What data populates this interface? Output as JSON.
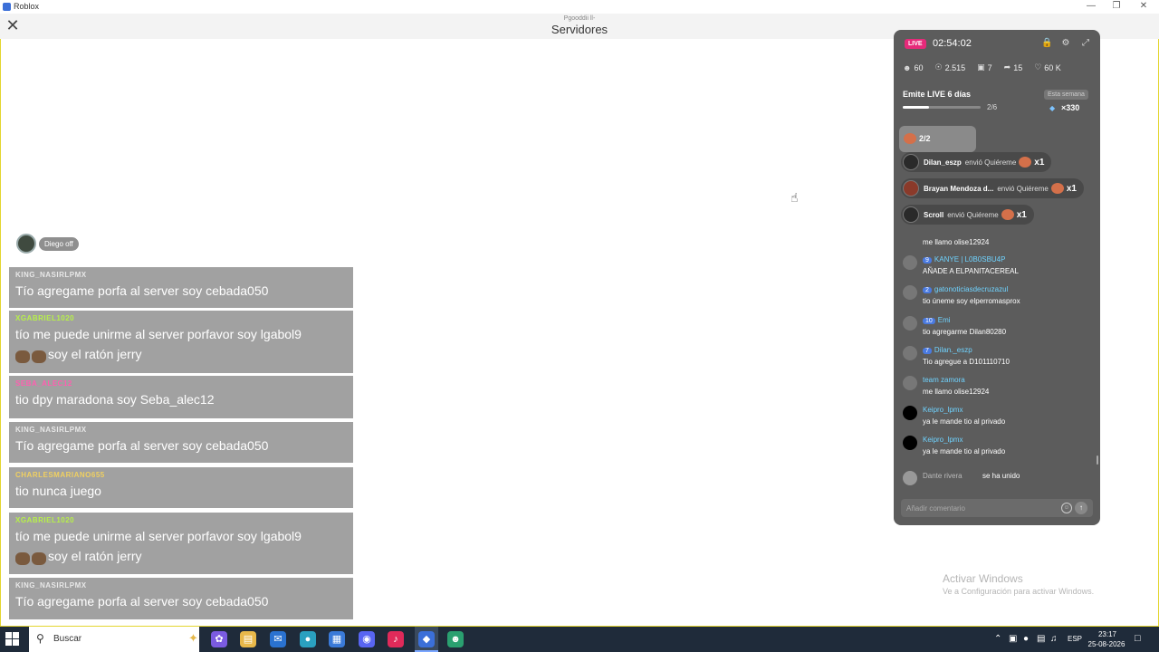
{
  "window": {
    "title": "Roblox",
    "minimize_icon": "minimize-icon",
    "maximize_icon": "maximize-icon",
    "close_icon": "close-icon"
  },
  "header": {
    "subtitle": "Pgooddii ll-",
    "title": "Servidores",
    "close_icon": "close-icon"
  },
  "viewer": {
    "name": "Diego off"
  },
  "chat": [
    {
      "user": "KING_NASIRLPMX",
      "user_color": "#e8e8e8",
      "text": "Tío agregame porfa al server soy cebada050",
      "emoji_prefix": false
    },
    {
      "user": "XGABRIEL1020",
      "user_color": "#b7f04a",
      "text": "tío me puede unirme al server porfavor soy lgabol9",
      "text2": "soy el ratón jerry",
      "emoji_prefix": true
    },
    {
      "user": "SEBA_ALEC12",
      "user_color": "#ff5fb0",
      "text": "tio dpy maradona soy Seba_alec12",
      "emoji_prefix": false
    },
    {
      "user": "KING_NASIRLPMX",
      "user_color": "#e8e8e8",
      "text": "Tío agregame porfa al server soy cebada050",
      "emoji_prefix": false
    },
    {
      "user": "CHARLESMARIANO655",
      "user_color": "#f0d060",
      "text": "tio nunca juego",
      "emoji_prefix": false
    },
    {
      "user": "XGABRIEL1020",
      "user_color": "#b7f04a",
      "text": "tío me puede unirme al server porfavor soy lgabol9",
      "text2": "soy el ratón jerry",
      "emoji_prefix": true
    },
    {
      "user": "KING_NASIRLPMX",
      "user_color": "#e8e8e8",
      "text": "Tío agregame porfa al server soy cebada050",
      "emoji_prefix": false
    }
  ],
  "live": {
    "badge": "LIVE",
    "time": "02:54:02",
    "icons": [
      "lock-icon",
      "gear-icon",
      "expand-icon"
    ],
    "stats": [
      {
        "icon": "users-icon",
        "value": "60"
      },
      {
        "icon": "eye-icon",
        "value": "2.515"
      },
      {
        "icon": "gift-box-icon",
        "value": "7"
      },
      {
        "icon": "share-icon",
        "value": "15"
      },
      {
        "icon": "heart-icon",
        "value": "60 K"
      }
    ],
    "goal": {
      "title": "Emite LIVE 6 días",
      "week": "Esta semana",
      "count": "2/6",
      "progress": 0.333,
      "reward": "×330"
    },
    "gift_counter": "2/2",
    "gifts": [
      {
        "name": "Dilan_eszp",
        "action": "envió Quiéreme",
        "mult": "x1"
      },
      {
        "name": "Brayan Mendoza d...",
        "action": "envió Quiéreme",
        "mult": "x1"
      },
      {
        "name": "Scroll",
        "action": "envió Quiéreme",
        "mult": "x1"
      }
    ],
    "partial_comment": "me llamo olise12924",
    "comments": [
      {
        "level": "9",
        "user": "KANYE | L0B0SBU4P",
        "text": "AÑADE A ELPANITACEREAL"
      },
      {
        "level": "2",
        "user": "gatonoticiasdecruzazul",
        "text": "tio úneme soy elperromasprox"
      },
      {
        "level": "10",
        "user": "Emi",
        "text": "tio agregarme Dilan80280"
      },
      {
        "level": "7",
        "user": "Dilan._eszp",
        "text": "Tio agregue a D101110710"
      },
      {
        "level": "",
        "user": "team zamora",
        "text": "me llamo olise12924"
      },
      {
        "level": "",
        "user": "Keipro_lpmx",
        "text": "ya le mande tio al privado"
      },
      {
        "level": "",
        "user": "Keipro_lpmx",
        "text": "ya le mande tio al privado"
      }
    ],
    "join": {
      "name": "Dante rivera",
      "action": "se ha unido"
    },
    "input_placeholder": "Añadir comentario"
  },
  "watermark": {
    "title": "Activar Windows",
    "subtitle": "Ve a Configuración para activar Windows."
  },
  "taskbar": {
    "search_placeholder": "Buscar",
    "apps": [
      "copilot-icon",
      "folder-icon",
      "outlook-icon",
      "edge-icon",
      "store-icon",
      "discord-icon",
      "tiktok-icon",
      "roblox-icon",
      "app-icon"
    ],
    "lang": "ESP",
    "time": "23:17",
    "date": "25-08-2026"
  }
}
